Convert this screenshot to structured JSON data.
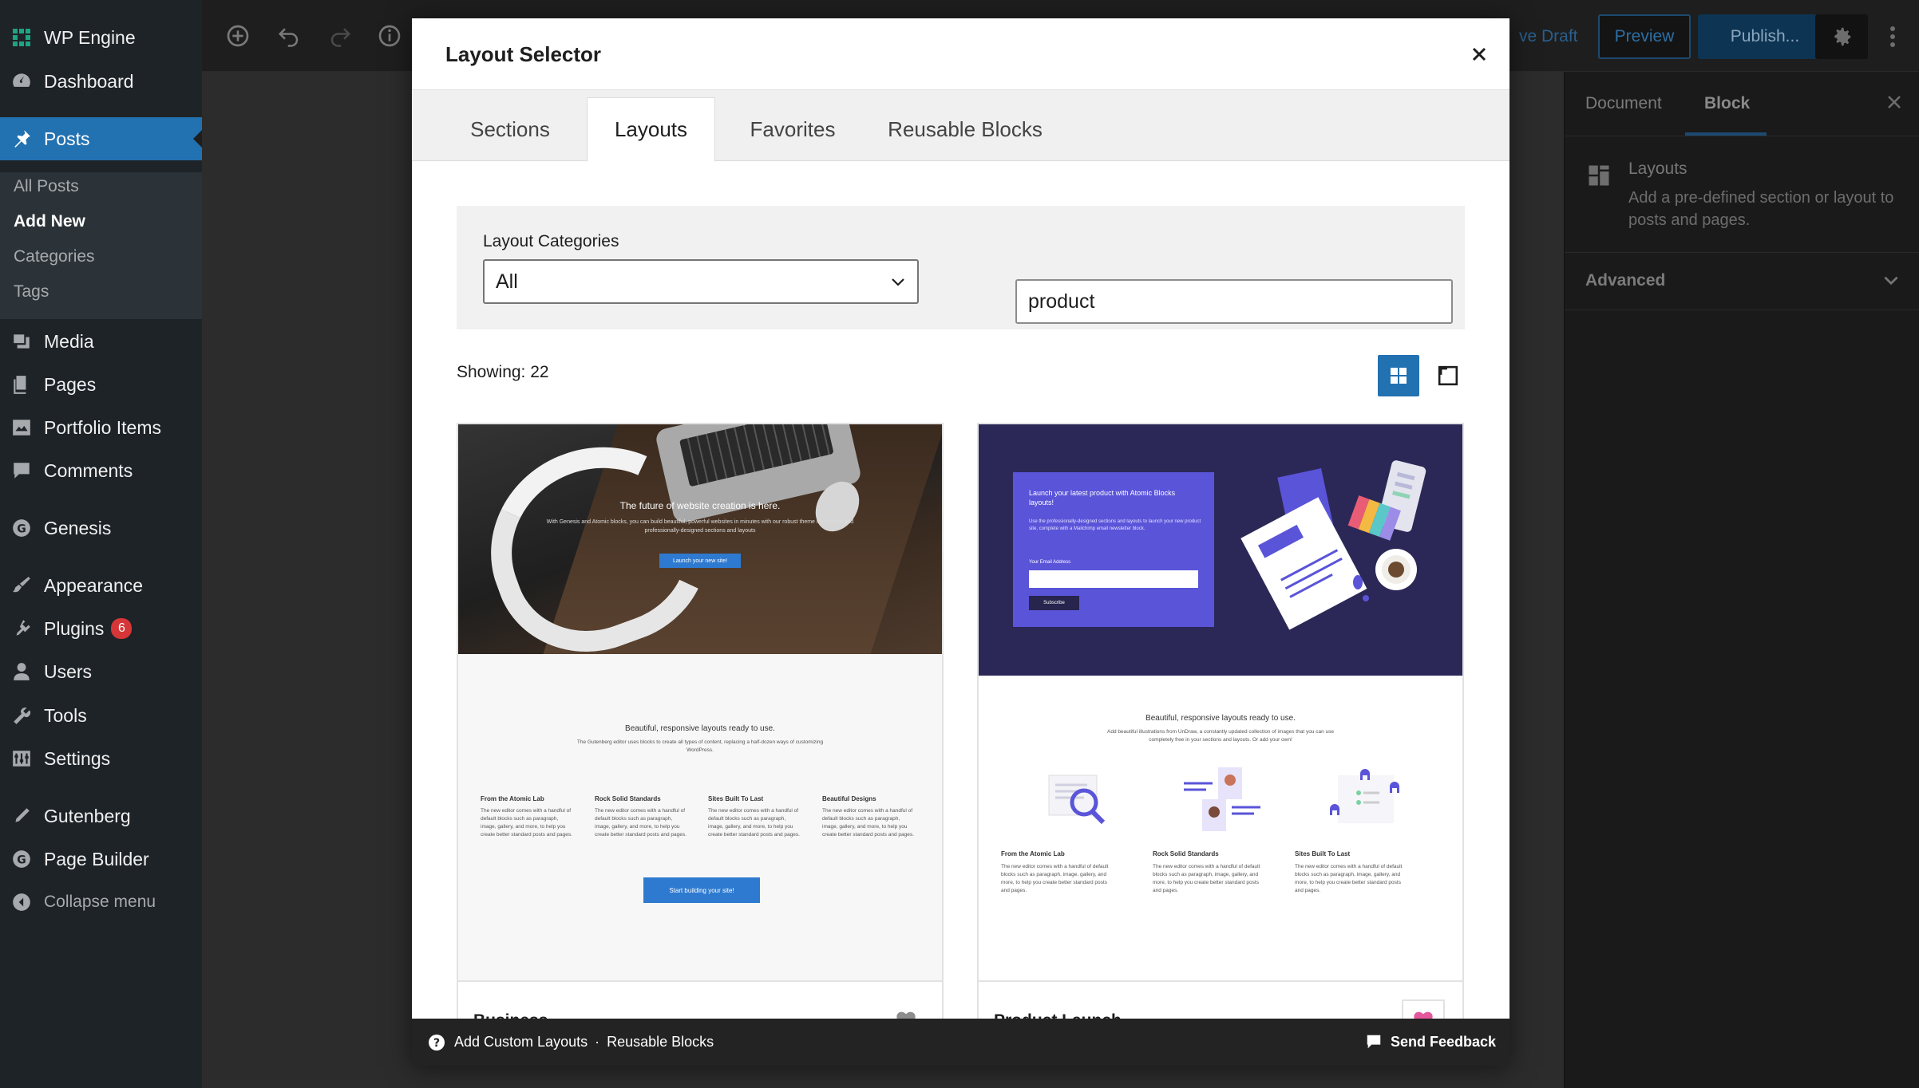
{
  "admin_menu": {
    "site_name": "WP Engine",
    "items": [
      {
        "label": "Dashboard",
        "icon": "dashboard-icon"
      },
      {
        "label": "Posts",
        "icon": "pushpin-icon"
      },
      {
        "label": "Media",
        "icon": "media-icon"
      },
      {
        "label": "Pages",
        "icon": "pages-icon"
      },
      {
        "label": "Portfolio Items",
        "icon": "portfolio-icon"
      },
      {
        "label": "Comments",
        "icon": "comments-icon"
      },
      {
        "label": "Genesis",
        "icon": "genesis-icon"
      },
      {
        "label": "Appearance",
        "icon": "appearance-icon"
      },
      {
        "label": "Plugins",
        "icon": "plugins-icon",
        "badge": "6"
      },
      {
        "label": "Users",
        "icon": "users-icon"
      },
      {
        "label": "Tools",
        "icon": "tools-icon"
      },
      {
        "label": "Settings",
        "icon": "settings-icon"
      },
      {
        "label": "Gutenberg",
        "icon": "gutenberg-icon"
      },
      {
        "label": "Page Builder",
        "icon": "page-builder-icon"
      }
    ],
    "posts_submenu": [
      "All Posts",
      "Add New",
      "Categories",
      "Tags"
    ],
    "collapse_label": "Collapse menu"
  },
  "editor_toolbar": {
    "save_draft": "ve Draft",
    "preview": "Preview",
    "publish": "Publish..."
  },
  "settings_panel": {
    "tab_document": "Document",
    "tab_block": "Block",
    "block_title": "Layouts",
    "block_description": "Add a pre-defined section or layout to posts and pages.",
    "advanced": "Advanced"
  },
  "modal": {
    "title": "Layout Selector",
    "tabs": [
      "Sections",
      "Layouts",
      "Favorites",
      "Reusable Blocks"
    ],
    "active_tab": "Layouts",
    "filter": {
      "categories_label": "Layout Categories",
      "categories_selected": "All",
      "search_value": "product"
    },
    "showing": "Showing: 22",
    "cards": [
      {
        "title": "Business",
        "favorited": false,
        "preview": {
          "hero_title": "The future of website creation is here.",
          "hero_subtitle": "With Genesis and Atomic blocks, you can build beautiful, powerful websites in minutes with our robust theme framework and professionally-designed sections and layouts",
          "hero_button": "Launch your new site!",
          "section_title": "Beautiful, responsive layouts ready to use.",
          "section_text": "The Gutenberg editor uses blocks to create all types of content, replacing a half-dozen ways of customizing WordPress.",
          "columns": [
            {
              "title": "From the Atomic Lab",
              "text": "The new editor comes with a handful of default blocks such as paragraph, image, gallery, and more, to help you create better standard posts and pages."
            },
            {
              "title": "Rock Solid Standards",
              "text": "The new editor comes with a handful of default blocks such as paragraph, image, gallery, and more, to help you create better standard posts and pages."
            },
            {
              "title": "Sites Built To Last",
              "text": "The new editor comes with a handful of default blocks such as paragraph, image, gallery, and more, to help you create better standard posts and pages."
            },
            {
              "title": "Beautiful Designs",
              "text": "The new editor comes with a handful of default blocks such as paragraph, image, gallery, and more, to help you create better standard posts and pages."
            }
          ],
          "cta": "Start building your site!"
        }
      },
      {
        "title": "Product Launch",
        "favorited": true,
        "preview": {
          "form_title": "Launch your latest product with Atomic Blocks layouts!",
          "form_text": "Use the professionally-designed sections and layouts to launch your new product site, complete with a Mailchimp email newsletter block.",
          "form_label": "Your Email Address",
          "form_button": "Subscribe",
          "section_title": "Beautiful, responsive layouts ready to use.",
          "section_text": "Add beautiful illustrations from UnDraw, a constantly updated collection of images that you can use completely free in your sections and layouts. Or add your own!",
          "columns": [
            {
              "title": "From the Atomic Lab",
              "text": "The new editor comes with a handful of default blocks such as paragraph, image, gallery, and more, to help you create better standard posts and pages."
            },
            {
              "title": "Rock Solid Standards",
              "text": "The new editor comes with a handful of default blocks such as paragraph, image, gallery, and more, to help you create better standard posts and pages."
            },
            {
              "title": "Sites Built To Last",
              "text": "The new editor comes with a handful of default blocks such as paragraph, image, gallery, and more, to help you create better standard posts and pages."
            }
          ]
        }
      }
    ],
    "footer": {
      "add_custom": "Add Custom Layouts",
      "separator": "·",
      "reusable": "Reusable Blocks",
      "feedback": "Send Feedback"
    }
  },
  "colors": {
    "admin_bg": "#1d2327",
    "accent": "#2271b1",
    "favorite_active": "#e5579c",
    "favorite_inactive": "#8c8c8c",
    "product_hero": "#2b2857",
    "product_form": "#5a54d9"
  }
}
